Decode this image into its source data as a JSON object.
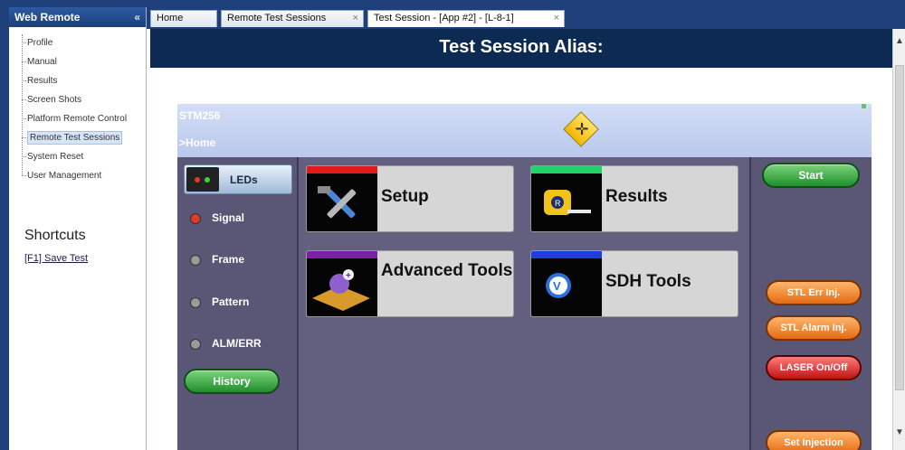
{
  "nav": {
    "title": "Web Remote",
    "collapse_glyph": "«",
    "items": [
      {
        "label": "Profile",
        "selected": false
      },
      {
        "label": "Manual",
        "selected": false
      },
      {
        "label": "Results",
        "selected": false
      },
      {
        "label": "Screen Shots",
        "selected": false
      },
      {
        "label": "Platform Remote Control",
        "selected": false
      },
      {
        "label": "Remote Test Sessions",
        "selected": true
      },
      {
        "label": "System Reset",
        "selected": false
      },
      {
        "label": "User Management",
        "selected": false
      }
    ],
    "shortcuts_title": "Shortcuts",
    "shortcut_link": "[F1] Save Test"
  },
  "tabs": [
    {
      "label": "Home",
      "closable": false,
      "active": false
    },
    {
      "label": "Remote Test Sessions",
      "closable": true,
      "active": false
    },
    {
      "label": "Test Session - [App #2] - [L-8-1]",
      "closable": true,
      "active": true
    }
  ],
  "tab_close_glyph": "×",
  "header": {
    "title": "Test Session Alias:"
  },
  "scrollbar": {
    "up_glyph": "▲",
    "down_glyph": "▼"
  },
  "device": {
    "model": "STM256",
    "breadcrumb": ">Home",
    "logo_icon": "crosshair-diamond-icon",
    "logo_glyph": "✛",
    "leds_label": "LEDs",
    "leds": [
      {
        "label": "Signal",
        "color": "#e03a2a"
      },
      {
        "label": "Frame",
        "color": "#9a9a9a"
      },
      {
        "label": "Pattern",
        "color": "#9a9a9a"
      },
      {
        "label": "ALM/ERR",
        "color": "#9a9a9a"
      }
    ],
    "history_label": "History",
    "tiles": [
      {
        "label": "Setup",
        "strip_color": "#e01b1b",
        "icon": "tools-icon"
      },
      {
        "label": "Results",
        "strip_color": "#1fd36a",
        "icon": "tape-measure-icon"
      },
      {
        "label": "Advanced Tools",
        "strip_color": "#7a1fa8",
        "icon": "advanced-tools-icon"
      },
      {
        "label": "SDH Tools",
        "strip_color": "#1c3fe0",
        "icon": "sdh-logo-icon"
      }
    ],
    "start_label": "Start",
    "action_buttons": {
      "stl_err_inj": "STL Err Inj.",
      "stl_alarm_inj": "STL Alarm Inj.",
      "laser_onoff": "LASER On/Off",
      "set_injection": "Set Injection"
    }
  }
}
